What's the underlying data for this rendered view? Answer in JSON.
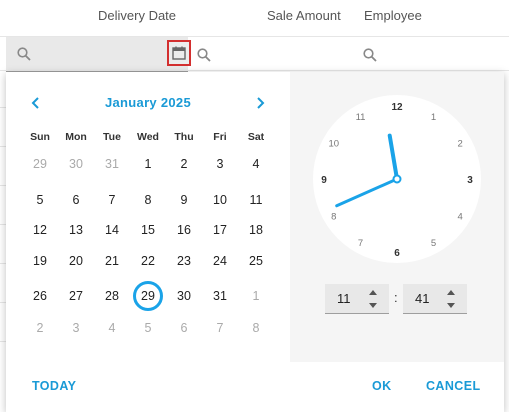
{
  "columns": {
    "delivery_date": "Delivery Date",
    "sale_amount": "Sale Amount",
    "employee": "Employee"
  },
  "calendar": {
    "month_title": "January 2025",
    "weekdays": [
      "Sun",
      "Mon",
      "Tue",
      "Wed",
      "Thu",
      "Fri",
      "Sat"
    ],
    "weeks": [
      [
        "29",
        "30",
        "31",
        "1",
        "2",
        "3",
        "4"
      ],
      [
        "5",
        "6",
        "7",
        "8",
        "9",
        "10",
        "11"
      ],
      [
        "12",
        "13",
        "14",
        "15",
        "16",
        "17",
        "18"
      ],
      [
        "19",
        "20",
        "21",
        "22",
        "23",
        "24",
        "25"
      ],
      [
        "26",
        "27",
        "28",
        "29",
        "30",
        "31",
        "1"
      ],
      [
        "2",
        "3",
        "4",
        "5",
        "6",
        "7",
        "8"
      ]
    ],
    "selected_day": "29"
  },
  "clock": {
    "numbers": [
      "12",
      "1",
      "2",
      "3",
      "4",
      "5",
      "6",
      "7",
      "8",
      "9",
      "10",
      "11"
    ],
    "hour": 11,
    "minute": 41
  },
  "time_input": {
    "hour": "11",
    "separator": ":",
    "minute": "41"
  },
  "footer": {
    "today": "TODAY",
    "ok": "OK",
    "cancel": "CANCEL"
  },
  "colors": {
    "accent": "#1a9ad6",
    "highlight_border": "#d32f2f"
  }
}
